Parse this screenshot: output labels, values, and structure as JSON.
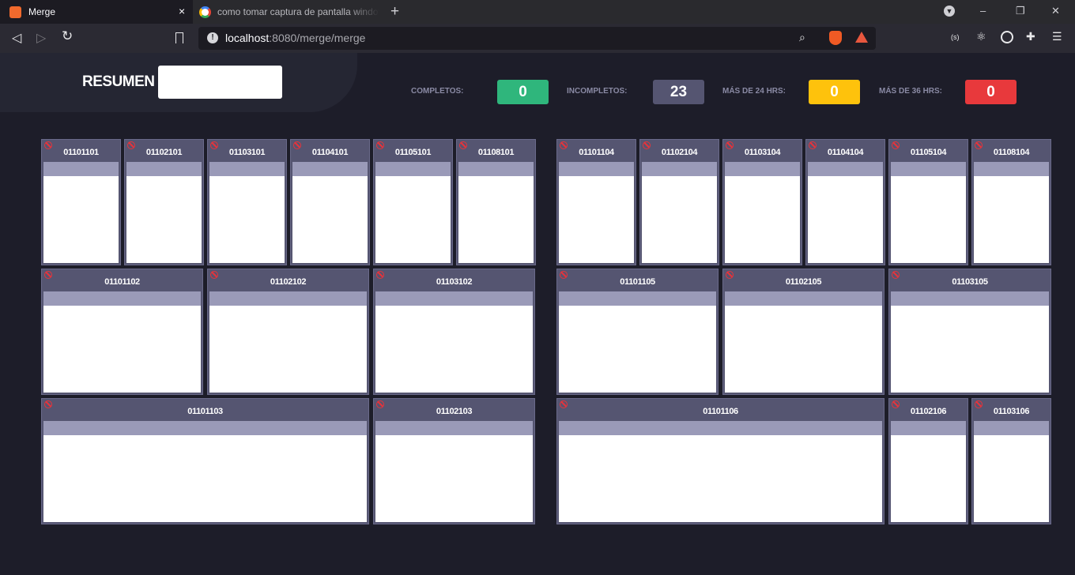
{
  "browser": {
    "tabs": [
      {
        "title": "Merge",
        "active": true
      },
      {
        "title": "como tomar captura de pantalla windows",
        "active": false
      }
    ],
    "close_icon": "×",
    "new_tab_icon": "+",
    "window_controls": {
      "minimize": "–",
      "restore": "❐",
      "close": "✕"
    },
    "url_host": "localhost",
    "url_rest": ":8080/merge/merge",
    "icons": [
      "back-icon",
      "forward-icon",
      "reload-icon",
      "bookmark-icon",
      "info-icon",
      "zoom-icon",
      "brave-icon",
      "bat-icon",
      "ext-s-icon",
      "react-icon",
      "target-icon",
      "puzzle-icon",
      "menu-icon"
    ]
  },
  "summary": {
    "label": "RESUMEN",
    "input_value": "",
    "stats": [
      {
        "label": "COMPLETOS:",
        "value": "0",
        "color": "#2fb67c"
      },
      {
        "label": "INCOMPLETOS:",
        "value": "23",
        "color": "#555571"
      },
      {
        "label": "MÁS DE 24 HRS:",
        "value": "0",
        "color": "#fec20c"
      },
      {
        "label": "MÁS DE 36 HRS:",
        "value": "0",
        "color": "#e8393c"
      }
    ]
  },
  "cards": [
    "01101101",
    "01102101",
    "01103101",
    "01104101",
    "01105101",
    "01108101",
    "01101104",
    "01102104",
    "01103104",
    "01104104",
    "01105104",
    "01108104",
    "01101102",
    "01102102",
    "01103102",
    "01101105",
    "01102105",
    "01103105",
    "01101103",
    "01102103",
    "01101106",
    "01102106",
    "01103106"
  ],
  "status_icon": "ban-icon"
}
